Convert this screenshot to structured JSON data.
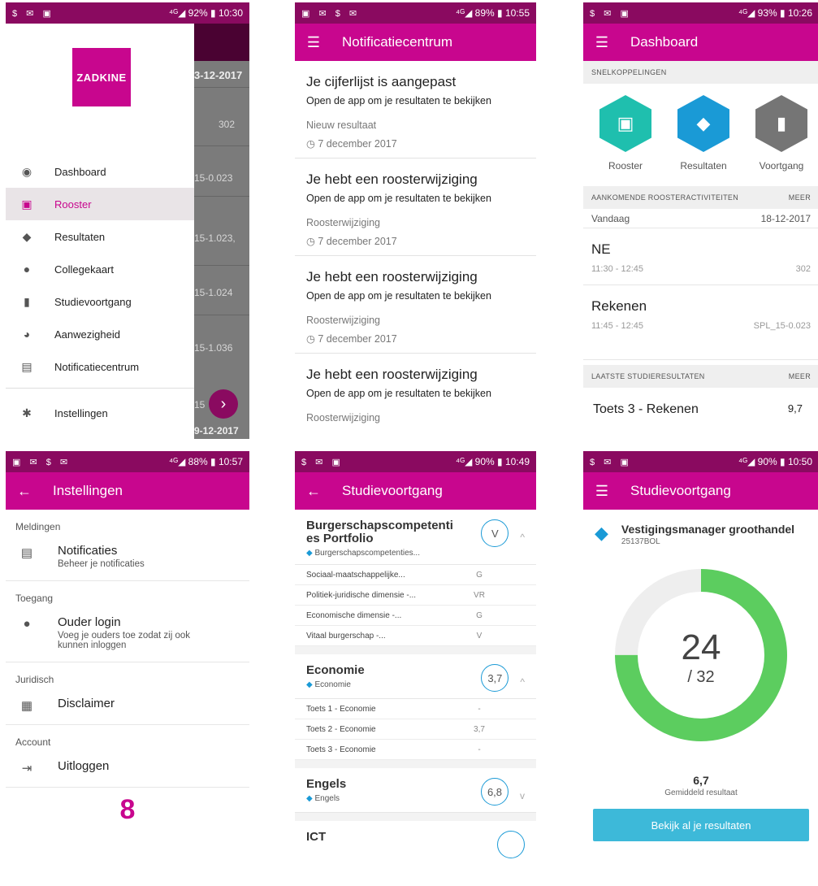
{
  "s1": {
    "status_left": "$ ✉ ▣",
    "status_right": "⁴ᴳ◢ 92% ▮ 10:30",
    "logo": "ZADKINE",
    "bg": {
      "date_top": "3-12-2017",
      "rows": [
        "302",
        "15-0.023",
        "15-1.023,",
        "15-1.024",
        "15-1.036",
        "15"
      ],
      "date_bottom": "9-12-2017"
    },
    "menu": [
      {
        "label": "Dashboard",
        "icon": "compass-icon",
        "glyph": "◉"
      },
      {
        "label": "Rooster",
        "icon": "calendar-icon",
        "glyph": "▣"
      },
      {
        "label": "Resultaten",
        "icon": "graduation-cap-icon",
        "glyph": "◆"
      },
      {
        "label": "Collegekaart",
        "icon": "person-icon",
        "glyph": "●"
      },
      {
        "label": "Studievoortgang",
        "icon": "bar-chart-icon",
        "glyph": "▮"
      },
      {
        "label": "Aanwezigheid",
        "icon": "people-icon",
        "glyph": "◕"
      },
      {
        "label": "Notificatiecentrum",
        "icon": "message-icon",
        "glyph": "▤"
      }
    ],
    "settings": {
      "label": "Instellingen",
      "glyph": "✱"
    }
  },
  "s2": {
    "status_left": "▣ ✉ $ ✉",
    "status_right": "⁴ᴳ◢ 89% ▮ 10:55",
    "title": "Notificatiecentrum",
    "items": [
      {
        "title": "Je cijferlijst is aangepast",
        "sub": "Open de app om je resultaten te bekijken",
        "cat": "Nieuw resultaat",
        "date": "◷ 7 december 2017"
      },
      {
        "title": "Je hebt een roosterwijziging",
        "sub": "Open de app om je resultaten te bekijken",
        "cat": "Roosterwijziging",
        "date": "◷ 7 december 2017"
      },
      {
        "title": "Je hebt een roosterwijziging",
        "sub": "Open de app om je resultaten te bekijken",
        "cat": "Roosterwijziging",
        "date": "◷ 7 december 2017"
      },
      {
        "title": "Je hebt een roosterwijziging",
        "sub": "Open de app om je resultaten te bekijken",
        "cat": "Roosterwijziging",
        "date": ""
      }
    ]
  },
  "s3": {
    "status_left": "$ ✉ ▣",
    "status_right": "⁴ᴳ◢ 93% ▮ 10:26",
    "title": "Dashboard",
    "shortcuts_head": "SNELKOPPELINGEN",
    "shortcuts": [
      {
        "label": "Rooster",
        "color": "#1fbfae",
        "glyph": "▣"
      },
      {
        "label": "Resultaten",
        "color": "#1a9ad6",
        "glyph": "◆"
      },
      {
        "label": "Voortgang",
        "color": "#757575",
        "glyph": "▮"
      }
    ],
    "upcoming_head": "AANKOMENDE ROOSTERACTIVITEITEN",
    "upcoming_more": "MEER",
    "day": "Vandaag",
    "date": "18-12-2017",
    "activities": [
      {
        "name": "NE",
        "time": "11:30 - 12:45",
        "room": "302"
      },
      {
        "name": "Rekenen",
        "time": "11:45 - 12:45",
        "room": "SPL_15-0.023"
      }
    ],
    "results_head": "LAATSTE STUDIERESULTATEN",
    "results_more": "MEER",
    "last_result": {
      "name": "Toets 3 - Rekenen",
      "grade": "9,7"
    }
  },
  "s4": {
    "status_left": "▣ ✉ $ ✉",
    "status_right": "⁴ᴳ◢ 88% ▮ 10:57",
    "title": "Instellingen",
    "groups": [
      {
        "title": "Meldingen",
        "item": "Notificaties",
        "sub": "Beheer je notificaties",
        "glyph": "▤"
      },
      {
        "title": "Toegang",
        "item": "Ouder login",
        "sub": "Voeg je ouders toe zodat zij ook kunnen inloggen",
        "glyph": "●"
      },
      {
        "title": "Juridisch",
        "item": "Disclaimer",
        "sub": "",
        "glyph": "▦"
      },
      {
        "title": "Account",
        "item": "Uitloggen",
        "sub": "",
        "glyph": "⇥"
      }
    ],
    "link_logo": "8"
  },
  "s5": {
    "status_left": "$ ✉ ▣",
    "status_right": "⁴ᴳ◢ 90% ▮ 10:49",
    "title": "Studievoortgang",
    "courses": [
      {
        "name": "Burgerschapscompetenti es Portfolio",
        "sub": "Burgerschapscompetenties...",
        "grade": "V",
        "chev": "^",
        "rows": [
          [
            "Sociaal-maatschappelijke...",
            "G"
          ],
          [
            "Politiek-juridische dimensie -...",
            "VR"
          ],
          [
            "Economische dimensie -...",
            "G"
          ],
          [
            "Vitaal burgerschap -...",
            "V"
          ]
        ]
      },
      {
        "name": "Economie",
        "sub": "Economie",
        "grade": "3,7",
        "chev": "^",
        "rows": [
          [
            "Toets 1 - Economie",
            "-"
          ],
          [
            "Toets 2 - Economie",
            "3,7"
          ],
          [
            "Toets 3 - Economie",
            "-"
          ]
        ]
      },
      {
        "name": "Engels",
        "sub": "Engels",
        "grade": "6,8",
        "chev": "v",
        "rows": []
      },
      {
        "name": "ICT",
        "sub": "",
        "grade": "",
        "chev": "",
        "rows": []
      }
    ]
  },
  "s6": {
    "status_left": "$ ✉ ▣",
    "status_right": "⁴ᴳ◢ 90% ▮ 10:50",
    "title": "Studievoortgang",
    "program": "Vestigingsmanager groothandel",
    "code": "25137BOL",
    "earned": "24",
    "total": "/ 32",
    "progress": 0.75,
    "ring_color": "#5ccd5f",
    "avg": "6,7",
    "avg_label": "Gemiddeld resultaat",
    "button": "Bekijk al je resultaten"
  }
}
